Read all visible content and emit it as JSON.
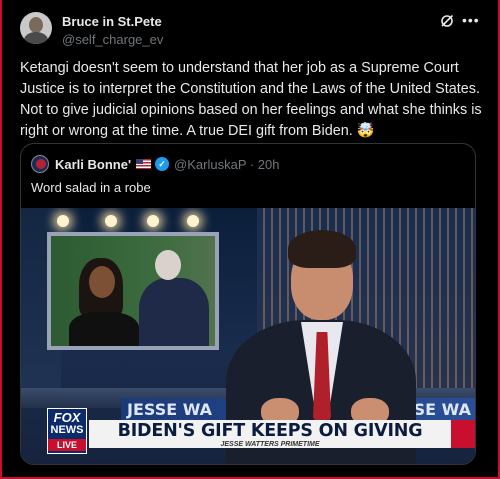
{
  "author": {
    "display_name": "Bruce in St.Pete",
    "handle": "@self_charge_ev"
  },
  "icons": {
    "grok": "grok-icon",
    "more": "more-icon",
    "verified": "verified-icon"
  },
  "tweet": {
    "text": "Ketangi doesn't seem to understand that her job as a Supreme Court Justice is to interpret the Constitution and the Laws of the United States. Not to give judicial opinions based on her feelings and what she thinks is right or wrong at the time. A true DEI gift from Biden. 🤯"
  },
  "quoted": {
    "display_name": "Karli Bonne'",
    "handle_time": "@KarluskaP · 20h",
    "text": "Word salad in a robe"
  },
  "media": {
    "background_banner_left": "JESSE WA",
    "background_banner_right": "SE WA",
    "logo_fox": "FOX",
    "logo_news": "NEWS",
    "logo_live": "LIVE",
    "chyron": "BIDEN'S GIFT KEEPS ON GIVING",
    "chyron_sub": "JESSE WATTERS PRIMETIME"
  },
  "colors": {
    "background": "#000000",
    "text": "#e7e9ea",
    "muted": "#71767b",
    "verified": "#1d9bf0",
    "fox_red": "#c8102e",
    "fox_blue": "#0b2b6b"
  }
}
